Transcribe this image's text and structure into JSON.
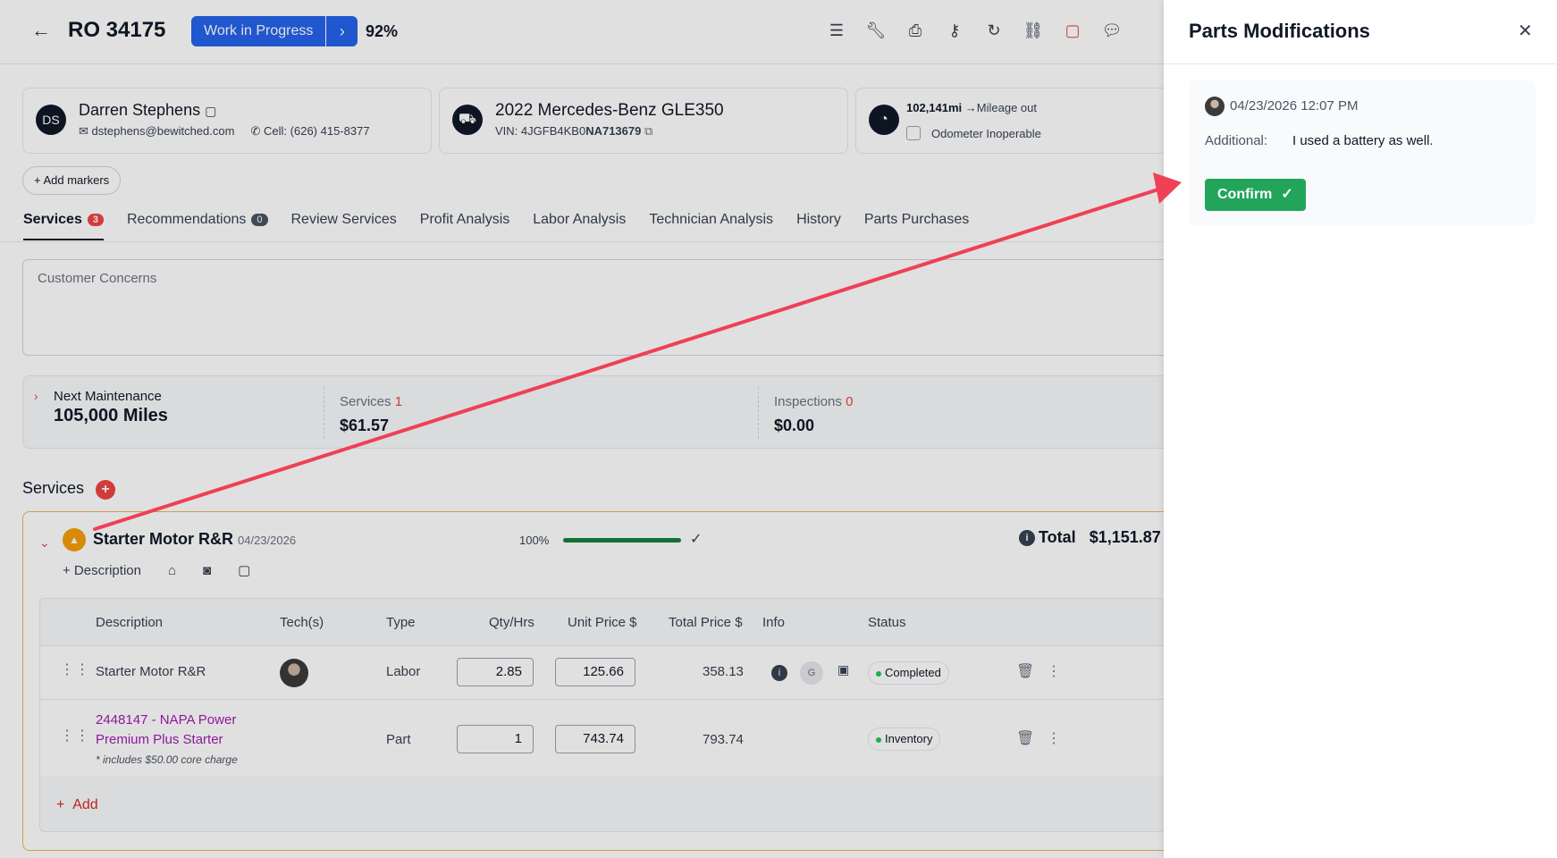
{
  "header": {
    "ro": "RO 34175",
    "status": "Work in Progress",
    "percent": "92%"
  },
  "customer": {
    "initials": "DS",
    "name": "Darren Stephens",
    "email": "dstephens@bewitched.com",
    "cell": "Cell: (626) 415-8377"
  },
  "vehicle": {
    "name": "2022 Mercedes-Benz GLE350",
    "vin_prefix": "VIN:",
    "vin_a": "4JGFB4KB0",
    "vin_b": "NA713679"
  },
  "mileage": {
    "value": "102,141mi",
    "out": "Mileage out",
    "odometer": "Odometer Inoperable"
  },
  "add_markers": "+ Add markers",
  "tabs": [
    {
      "label": "Services",
      "badge": "3"
    },
    {
      "label": "Recommendations",
      "badge": "0"
    },
    {
      "label": "Review Services"
    },
    {
      "label": "Profit Analysis"
    },
    {
      "label": "Labor Analysis"
    },
    {
      "label": "Technician Analysis"
    },
    {
      "label": "History"
    },
    {
      "label": "Parts Purchases"
    }
  ],
  "concerns_placeholder": "Customer Concerns",
  "stats": {
    "next_maint_label": "Next Maintenance",
    "next_maint_value": "105,000 Miles",
    "services_label": "Services",
    "services_count": "1",
    "services_value": "$61.57",
    "inspections_label": "Inspections",
    "inspections_count": "0",
    "inspections_value": "$0.00"
  },
  "services_heading": "Services",
  "service": {
    "name": "Starter Motor R&R",
    "date": "04/23/2026",
    "progress_text": "100%",
    "progress": 1.0,
    "total_label": "Total",
    "total_value": "$1,151.87",
    "description_btn": "+ Description",
    "columns": [
      "Description",
      "Tech(s)",
      "Type",
      "Qty/Hrs",
      "Unit Price $",
      "Total Price $",
      "Info",
      "Status"
    ],
    "rows": [
      {
        "description": "Starter Motor R&R",
        "type": "Labor",
        "qty": "2.85",
        "unit": "125.66",
        "total": "358.13",
        "status": "Completed",
        "info_g": "G"
      },
      {
        "description_l1": "2448147 - NAPA Power",
        "description_l2": "Premium Plus Starter",
        "note": "* includes $50.00 core charge",
        "type": "Part",
        "qty": "1",
        "unit": "743.74",
        "total": "793.74",
        "status": "Inventory"
      }
    ],
    "add_label": "Add"
  },
  "panel": {
    "title": "Parts Modifications",
    "date": "04/23/2026 12:07 PM",
    "label": "Additional:",
    "value": "I used a battery as well.",
    "confirm": "Confirm"
  },
  "colors": {
    "primary": "#2563eb",
    "accent_red": "#ef4444",
    "confirm_green": "#22a55b",
    "annotation_arrow": "#ef4056"
  }
}
